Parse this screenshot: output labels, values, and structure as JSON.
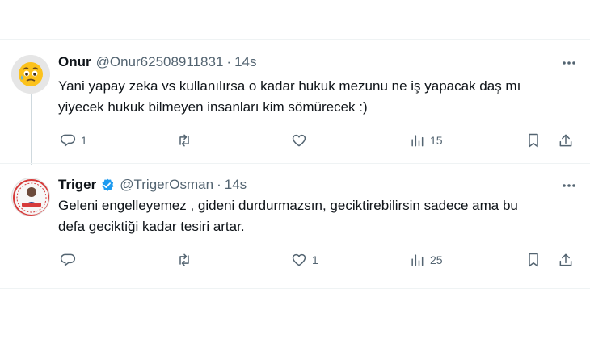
{
  "tweets": [
    {
      "name": "Onur",
      "handle": "@Onur62508911831",
      "separator": "·",
      "time": "14s",
      "text_lines": [
        "Yani yapay zeka vs kullanılırsa o kadar hukuk mezunu ne iş yapacak daş mı",
        "yiyecek hukuk bilmeyen insanları kim sömürecek :)"
      ],
      "replies": "1",
      "retweets": "",
      "likes": "",
      "views": "15",
      "avatar_icon": "worried-face-emoji"
    },
    {
      "name": "Triger",
      "handle": "@TrigerOsman",
      "separator": "·",
      "time": "14s",
      "verified": true,
      "text_lines": [
        "Geleni engelleyemez , gideni durdurmazsın, geciktirebilirsin sadece ama bu",
        "defa geciktiği kadar tesiri artar."
      ],
      "replies": "",
      "retweets": "",
      "likes": "1",
      "views": "25",
      "avatar_icon": "profile-photo"
    }
  ],
  "colors": {
    "text": "#0f1419",
    "secondary": "#536471",
    "verified": "#1d9bf0",
    "divider": "#eff3f4",
    "thread_line": "#cfd9de"
  }
}
